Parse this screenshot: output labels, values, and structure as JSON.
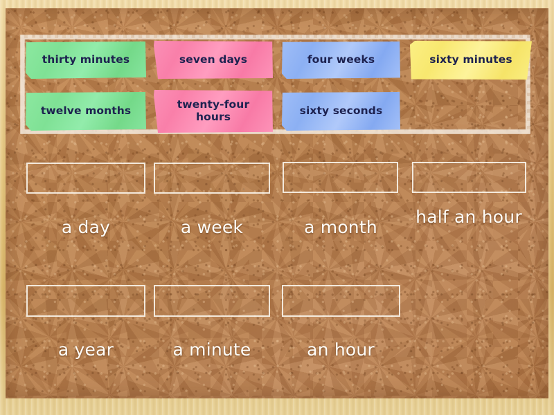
{
  "activity": {
    "type": "match-up-drag-and-drop",
    "board_style": "cork-board",
    "colors": {
      "cork": "#b9814f",
      "wood_frame": "#e9cd8c",
      "tile_green": "#84e59c",
      "tile_pink": "#fb8cb2",
      "tile_blue": "#9bbaf6",
      "tile_yellow": "#faed7e",
      "tile_text": "#1d2250",
      "chalk_white": "#fffdf8"
    }
  },
  "word_bank": {
    "name": "word-bank",
    "tiles": [
      {
        "label": "thirty minutes",
        "color": "green",
        "row": 1,
        "col": 1
      },
      {
        "label": "seven days",
        "color": "pink",
        "row": 1,
        "col": 2
      },
      {
        "label": "four weeks",
        "color": "blue",
        "row": 1,
        "col": 3
      },
      {
        "label": "sixty minutes",
        "color": "yellow",
        "row": 1,
        "col": 4
      },
      {
        "label": "twelve months",
        "color": "green",
        "row": 2,
        "col": 1
      },
      {
        "label": "twenty-four hours",
        "color": "pink",
        "row": 2,
        "col": 2
      },
      {
        "label": "sixty seconds",
        "color": "blue",
        "row": 2,
        "col": 3
      }
    ]
  },
  "answer_slots": [
    {
      "label": "a day",
      "value": "",
      "row": 1,
      "col": 1
    },
    {
      "label": "a week",
      "value": "",
      "row": 1,
      "col": 2
    },
    {
      "label": "a month",
      "value": "",
      "row": 1,
      "col": 3
    },
    {
      "label": "half an hour",
      "value": "",
      "row": 1,
      "col": 4
    },
    {
      "label": "a year",
      "value": "",
      "row": 2,
      "col": 1
    },
    {
      "label": "a minute",
      "value": "",
      "row": 2,
      "col": 2
    },
    {
      "label": "an hour",
      "value": "",
      "row": 2,
      "col": 3
    }
  ]
}
